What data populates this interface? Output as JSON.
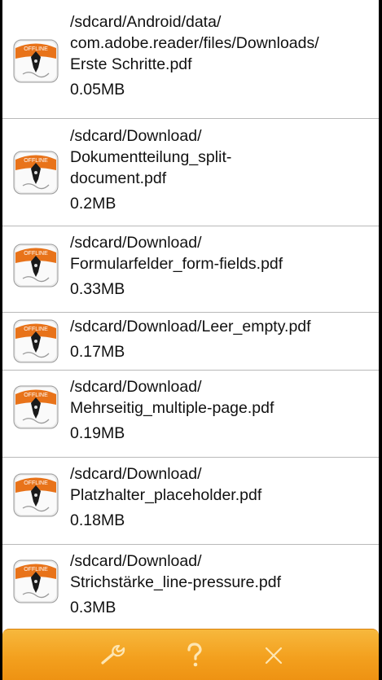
{
  "files": [
    {
      "path_lines": [
        "/sdcard/Android/data/",
        "com.adobe.reader/files/Downloads/",
        "Erste Schritte.pdf"
      ],
      "size": "0.05MB"
    },
    {
      "path_lines": [
        "/sdcard/Download/",
        "Dokumentteilung_split-",
        "document.pdf"
      ],
      "size": "0.2MB"
    },
    {
      "path_lines": [
        "/sdcard/Download/",
        "Formularfelder_form-fields.pdf"
      ],
      "size": "0.33MB"
    },
    {
      "path_lines": [
        "/sdcard/Download/Leer_empty.pdf"
      ],
      "size": "0.17MB"
    },
    {
      "path_lines": [
        "/sdcard/Download/",
        "Mehrseitig_multiple-page.pdf"
      ],
      "size": "0.19MB"
    },
    {
      "path_lines": [
        "/sdcard/Download/",
        "Platzhalter_placeholder.pdf"
      ],
      "size": "0.18MB"
    },
    {
      "path_lines": [
        "/sdcard/Download/",
        "Strichstärke_line-pressure.pdf"
      ],
      "size": "0.3MB"
    }
  ],
  "file_icon": {
    "name": "app-offline-pen-icon",
    "badge_text": "OFFLINE"
  },
  "toolbar": {
    "buttons": [
      {
        "name": "settings-wrench-icon"
      },
      {
        "name": "help-question-icon"
      },
      {
        "name": "close-x-icon"
      }
    ]
  },
  "colors": {
    "toolbar_orange": "#f3a01e",
    "toolbar_icon": "#fde6b3",
    "badge_orange": "#e8731a",
    "divider": "#b9b9b9",
    "text": "#111111"
  }
}
